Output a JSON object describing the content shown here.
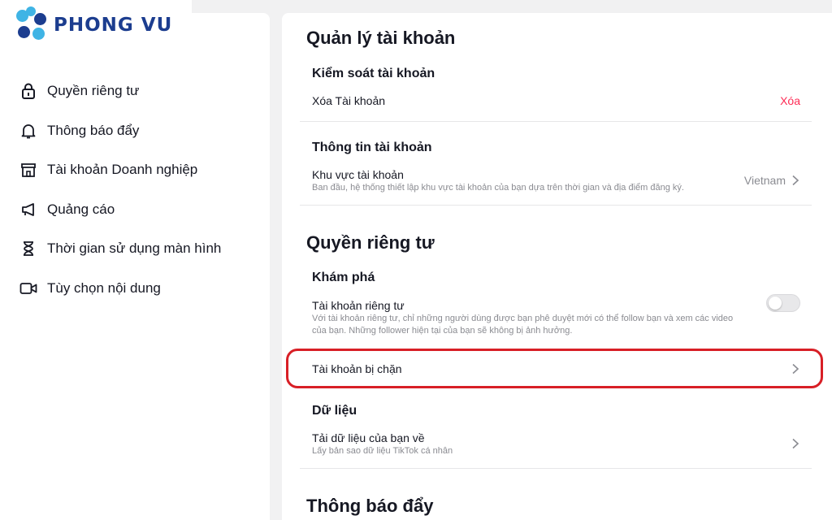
{
  "logo": {
    "text": "PHONG VU",
    "colors": {
      "light": "#3fb4e5",
      "dark": "#1c3d8f"
    }
  },
  "sidebar": {
    "items": [
      {
        "label": "Quyền riêng tư",
        "icon": "lock-icon"
      },
      {
        "label": "Thông báo đẩy",
        "icon": "bell-icon"
      },
      {
        "label": "Tài khoản Doanh nghiệp",
        "icon": "store-icon"
      },
      {
        "label": "Quảng cáo",
        "icon": "megaphone-icon"
      },
      {
        "label": "Thời gian sử dụng màn hình",
        "icon": "hourglass-icon"
      },
      {
        "label": "Tùy chọn nội dung",
        "icon": "video-icon"
      }
    ]
  },
  "main": {
    "account_management": {
      "title": "Quản lý tài khoản",
      "control": {
        "title": "Kiểm soát tài khoản",
        "delete_label": "Xóa Tài khoản",
        "delete_action": "Xóa"
      },
      "info": {
        "title": "Thông tin tài khoản",
        "region_label": "Khu vực tài khoản",
        "region_desc": "Ban đầu, hệ thống thiết lập khu vực tài khoản của bạn dựa trên thời gian và địa điểm đăng ký.",
        "region_value": "Vietnam"
      }
    },
    "privacy": {
      "title": "Quyền riêng tư",
      "discovery": {
        "title": "Khám phá",
        "private_label": "Tài khoản riêng tư",
        "private_desc_1": "Với tài khoản riêng tư, chỉ những người dùng được bạn phê duyệt mới có thể follow bạn và xem các video",
        "private_desc_2": "của bạn. Những follower hiện tại của bạn sẽ không bị ảnh hưởng.",
        "private_enabled": false
      },
      "blocked_label": "Tài khoản bị chặn",
      "data": {
        "title": "Dữ liệu",
        "download_label": "Tải dữ liệu của bạn về",
        "download_desc": "Lấy bản sao dữ liệu TikTok cá nhân"
      }
    },
    "push": {
      "title": "Thông báo đẩy"
    }
  },
  "colors": {
    "accent": "#fe2c55",
    "highlight": "#d81f26"
  }
}
